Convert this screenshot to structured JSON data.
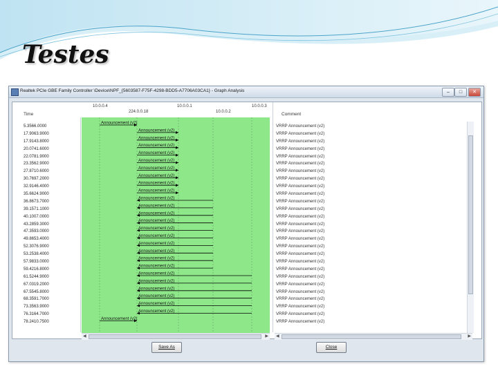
{
  "slide": {
    "title": "Testes"
  },
  "window": {
    "title": "Realtek PCIe GBE Family Controller \\Device\\NPF_{5603587-F75F-4298-BDD5-A7706A03CA1} - Graph Analysis",
    "controls": {
      "minimize": "–",
      "maximize": "□",
      "close": "✕"
    }
  },
  "columns": {
    "time": "Time",
    "comment": "Comment"
  },
  "nodes": {
    "top": [
      "10.0.0.4",
      "10.0.0.1",
      "10.0.0.3"
    ],
    "bottom": [
      "224.0.0.18",
      "10.0.0.2"
    ]
  },
  "times": [
    "5.3566.0000",
    "17.9063.9000",
    "17.9143.8000",
    "20.0741.6000",
    "22.0781.9000",
    "23.3562.9000",
    "27.8710.6000",
    "30.7697.2000",
    "32.9146.4000",
    "35.6624.9000",
    "36.8673.7000",
    "39.1571.1000",
    "40.1007.0000",
    "43.2859.3000",
    "47.3593.0000",
    "49.8653.4000",
    "52.3076.9000",
    "53.2538.4000",
    "57.9833.0000",
    "59.4216.8000",
    "61.5244.9000",
    "67.0319.2000",
    "67.5545.8000",
    "68.3591.7000",
    "73.3563.9000",
    "76.3164.7000",
    "78.2410.7500"
  ],
  "arrows": [
    {
      "label": "Announcement (v2)",
      "from": 0,
      "to": 1
    },
    {
      "label": "Announcement (v2)",
      "from": 1,
      "to": 2
    },
    {
      "label": "Announcement (v2)",
      "from": 1,
      "to": 2
    },
    {
      "label": "Announcement (v2)",
      "from": 1,
      "to": 2
    },
    {
      "label": "Announcement (v2)",
      "from": 1,
      "to": 2
    },
    {
      "label": "Announcement (v2)",
      "from": 1,
      "to": 2
    },
    {
      "label": "Announcement (v2)",
      "from": 1,
      "to": 2
    },
    {
      "label": "Announcement (v2)",
      "from": 1,
      "to": 2
    },
    {
      "label": "Announcement (v2)",
      "from": 1,
      "to": 2
    },
    {
      "label": "Announcement (v2)",
      "from": 1,
      "to": 2
    },
    {
      "label": "Announcement (v2)",
      "from": 3,
      "to": 1
    },
    {
      "label": "Announcement (v2)",
      "from": 3,
      "to": 1
    },
    {
      "label": "Announcement (v2)",
      "from": 3,
      "to": 1
    },
    {
      "label": "Announcement (v2)",
      "from": 3,
      "to": 1
    },
    {
      "label": "Announcement (v2)",
      "from": 3,
      "to": 1
    },
    {
      "label": "Announcement (v2)",
      "from": 3,
      "to": 1
    },
    {
      "label": "Announcement (v2)",
      "from": 3,
      "to": 1
    },
    {
      "label": "Announcement (v2)",
      "from": 3,
      "to": 1
    },
    {
      "label": "Announcement (v2)",
      "from": 3,
      "to": 1
    },
    {
      "label": "Announcement (v2)",
      "from": 3,
      "to": 1
    },
    {
      "label": "Announcement (v2)",
      "from": 4,
      "to": 1
    },
    {
      "label": "Announcement (v2)",
      "from": 4,
      "to": 1
    },
    {
      "label": "Announcement (v2)",
      "from": 4,
      "to": 1
    },
    {
      "label": "Announcement (v2)",
      "from": 4,
      "to": 1
    },
    {
      "label": "Announcement (v2)",
      "from": 4,
      "to": 1
    },
    {
      "label": "Announcement (v2)",
      "from": 4,
      "to": 1
    },
    {
      "label": "Announcement (v2)",
      "from": 0,
      "to": 1
    }
  ],
  "comments": [
    "VRRP Announcement (v2)",
    "VRRP Announcement (v2)",
    "VRRP Announcement (v2)",
    "VRRP Announcement (v2)",
    "VRRP Announcement (v2)",
    "VRRP Announcement (v2)",
    "VRRP Announcement (v2)",
    "VRRP Announcement (v2)",
    "VRRP Announcement (v2)",
    "VRRP Announcement (v2)",
    "VRRP Announcement (v2)",
    "VRRP Announcement (v2)",
    "VRRP Announcement (v2)",
    "VRRP Announcement (v2)",
    "VRRP Announcement (v2)",
    "VRRP Announcement (v2)",
    "VRRP Announcement (v2)",
    "VRRP Announcement (v2)",
    "VRRP Announcement (v2)",
    "VRRP Announcement (v2)",
    "VRRP Announcement (v2)",
    "VRRP Announcement (v2)",
    "VRRP Announcement (v2)",
    "VRRP Announcement (v2)",
    "VRRP Announcement (v2)",
    "VRRP Announcement (v2)",
    "VRRP Announcement (v2)"
  ],
  "buttons": {
    "save_as": "Save As",
    "close": "Close"
  },
  "colors": {
    "graph_bg": "#8ee88a",
    "arrow": "#000000",
    "node_line": "#6aa86a"
  }
}
